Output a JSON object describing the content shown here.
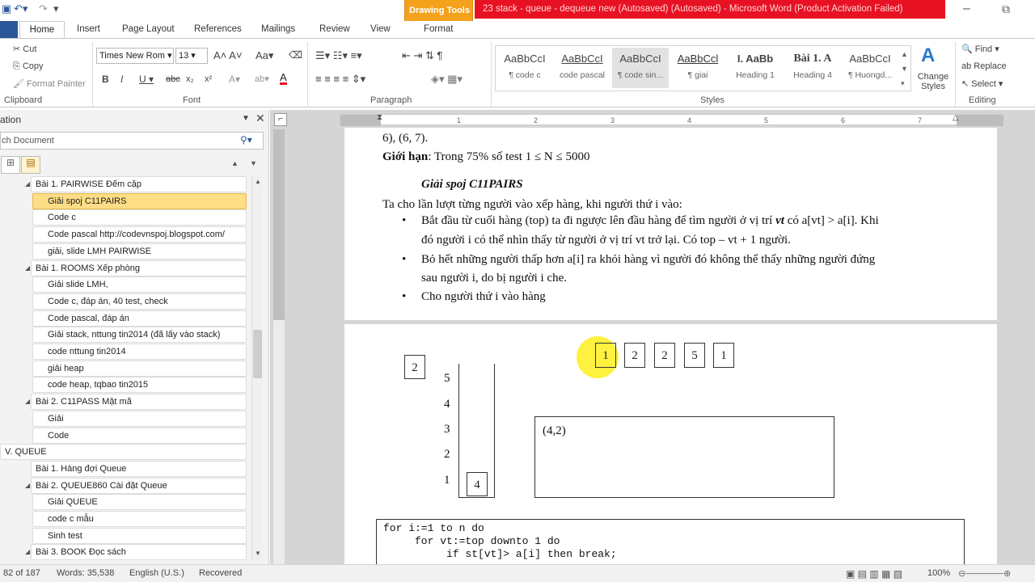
{
  "titlebar": {
    "drawing_tools": "Drawing Tools",
    "title": "23 stack - queue - dequeue new (Autosaved) (Autosaved)  -  Microsoft Word (Product Activation Failed)"
  },
  "tabs": [
    {
      "label": "Home"
    },
    {
      "label": "Insert"
    },
    {
      "label": "Page Layout"
    },
    {
      "label": "References"
    },
    {
      "label": "Mailings"
    },
    {
      "label": "Review"
    },
    {
      "label": "View"
    },
    {
      "label": "Format"
    }
  ],
  "ribbon": {
    "clipboard": {
      "cut": "Cut",
      "copy": "Copy",
      "format_painter": "Format Painter",
      "label": "Clipboard"
    },
    "font": {
      "name": "Times New Rom",
      "size": "13",
      "label": "Font"
    },
    "paragraph": {
      "label": "Paragraph"
    },
    "styles": {
      "label": "Styles",
      "items": [
        {
          "preview": "AaBbCcI",
          "name": "¶ code c"
        },
        {
          "preview": "AaBbCcI",
          "name": "code pascal"
        },
        {
          "preview": "AaBbCcI",
          "name": "¶ code sin..."
        },
        {
          "preview": "AaBbCcl",
          "name": "¶ giai"
        },
        {
          "preview": "I.  AaBb",
          "name": "Heading 1"
        },
        {
          "preview": "Bài 1.  A",
          "name": "Heading 4"
        },
        {
          "preview": "AaBbCcI",
          "name": "¶ Huongd..."
        }
      ],
      "change": "Change Styles"
    },
    "editing": {
      "find": "Find",
      "replace": "Replace",
      "select": "Select",
      "label": "Editing"
    }
  },
  "nav": {
    "title": "ation",
    "search_placeholder": "ch Document",
    "items": [
      {
        "label": "Bài 1. PAIRWISE Đếm cặp",
        "level": 1
      },
      {
        "label": "Giải spoj C11PAIRS",
        "level": 2,
        "selected": true
      },
      {
        "label": "Code c",
        "level": 2
      },
      {
        "label": "Code pascal http://codevnspoj.blogspot.com/",
        "level": 2
      },
      {
        "label": "giải, slide LMH PAIRWISE",
        "level": 2
      },
      {
        "label": "Bài 1. ROOMS Xếp phòng",
        "level": 1
      },
      {
        "label": "Giải slide LMH,",
        "level": 2
      },
      {
        "label": "Code c, đáp án, 40 test, check",
        "level": 2
      },
      {
        "label": "Code pascal, đáp án",
        "level": 2
      },
      {
        "label": "Giải stack, nttung tin2014 (đã lấy vào stack)",
        "level": 2
      },
      {
        "label": "code nttung tin2014",
        "level": 2
      },
      {
        "label": "giải heap",
        "level": 2
      },
      {
        "label": "code heap, tqbao tin2015",
        "level": 2
      },
      {
        "label": "Bài 2. C11PASS Mật mã",
        "level": 1
      },
      {
        "label": "Giải",
        "level": 2
      },
      {
        "label": "Code",
        "level": 2
      },
      {
        "label": "V. QUEUE",
        "level": 0
      },
      {
        "label": "Bài 1. Hàng đợi Queue",
        "level": 1,
        "leaf": true
      },
      {
        "label": "Bài 2. QUEUE860 Cài đặt Queue",
        "level": 1
      },
      {
        "label": "Giải QUEUE",
        "level": 2
      },
      {
        "label": "code c mẫu",
        "level": 2
      },
      {
        "label": "Sinh test",
        "level": 2
      },
      {
        "label": "Bài 3. BOOK Đọc sách",
        "level": 1
      }
    ]
  },
  "doc": {
    "line1": "6), (6, 7).",
    "limit_label": "Giới hạn",
    "limit_text": ": Trong 75% số test 1 ≤ N ≤ 5000",
    "heading": "Giải spoj C11PAIRS",
    "intro": "Ta cho lần lượt từng người vào xếp hàng, khi người thứ i vào:",
    "b1a": "Bắt đầu từ cuối hàng (top) ta đi ngược lên đầu hàng để tìm người ở vị trí ",
    "b1vt": "vt",
    "b1b": " có a[vt] > a[i]. Khi",
    "b1c": "đó người i có thể nhìn thấy từ người ở vị trí vt trở lại. Có top – vt + 1 người.",
    "b2a": "Bỏ hết những người thấp hơn a[i] ra khỏi hàng vì người đó không thể thấy những người đứng",
    "b2b": "sau người i, do bị người i che.",
    "b3": "Cho người thứ i vào hàng",
    "diagram": {
      "current": "2",
      "stack_labels": [
        "5",
        "4",
        "3",
        "2",
        "1"
      ],
      "stack_top": "4",
      "sequence": [
        "1",
        "2",
        "2",
        "5",
        "1"
      ],
      "pair": "(4,2)"
    },
    "code": [
      "for i:=1 to n do",
      "     for vt:=top downto 1 do",
      "          if st[vt]> a[i] then break;"
    ]
  },
  "status": {
    "page": "82 of 187",
    "words": "Words: 35,538",
    "lang": "English (U.S.)",
    "recovered": "Recovered",
    "zoom": "100%"
  }
}
